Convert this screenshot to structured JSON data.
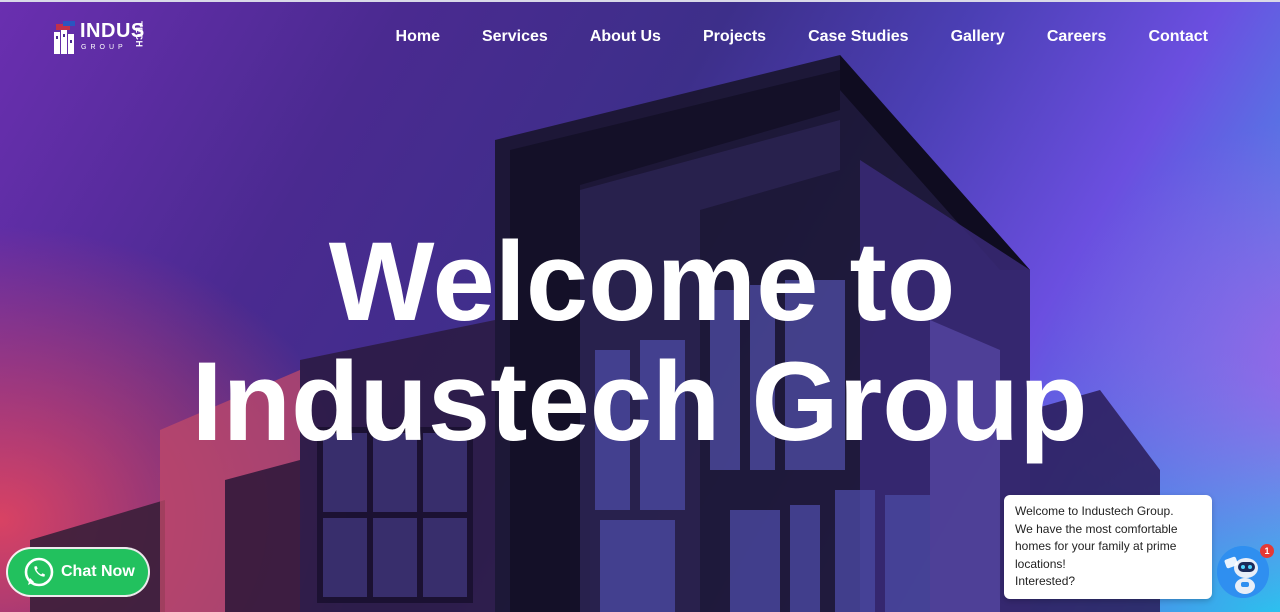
{
  "brand": {
    "name": "INDUS",
    "tag": "TECH",
    "sub": "GROUP"
  },
  "nav": {
    "items": [
      {
        "label": "Home"
      },
      {
        "label": "Services"
      },
      {
        "label": "About Us"
      },
      {
        "label": "Projects"
      },
      {
        "label": "Case Studies"
      },
      {
        "label": "Gallery"
      },
      {
        "label": "Careers"
      },
      {
        "label": "Contact"
      }
    ]
  },
  "hero": {
    "line1": "Welcome to",
    "line2": "Industech Group"
  },
  "whatsapp": {
    "label": "Chat Now",
    "color": "#22c15e"
  },
  "chat": {
    "lines": [
      "Welcome to Industech Group.",
      "We have the most comfortable",
      "homes for your family at prime",
      "locations!",
      "Interested?"
    ],
    "badge": "1"
  },
  "colors": {
    "accent_blue": "#2cc1ee",
    "accent_purple": "#6a2fb0",
    "accent_red": "#f0465a"
  }
}
